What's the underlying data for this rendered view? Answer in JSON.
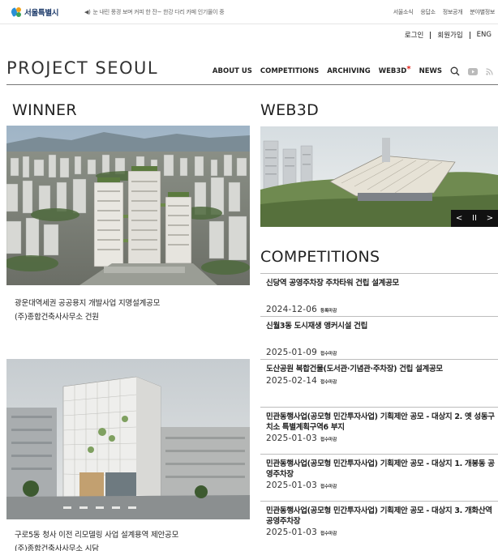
{
  "govbar": {
    "logo_text": "서울특별시",
    "ticker": "눈 내린 풍경 보며 커피 한 잔~ 한강 다리 카페 인기몰이 중",
    "links": [
      "서울소식",
      "응답소",
      "정보공개",
      "분야별정보"
    ]
  },
  "userbar": {
    "login": "로그인",
    "signup": "회원가입",
    "lang": "ENG"
  },
  "brand": {
    "title": "PROJECT SEOUL"
  },
  "nav": {
    "items": [
      "ABOUT US",
      "COMPETITIONS",
      "ARCHIVING",
      "WEB3D",
      "NEWS"
    ],
    "star": "*",
    "icons": [
      "search-icon",
      "youtube-icon",
      "rss-icon"
    ]
  },
  "winner": {
    "title": "WINNER",
    "items": [
      {
        "line1": "광운대역세권 공공용지 개발사업 지명설계공모",
        "line2": "(주)종합건축사사무소 건원"
      },
      {
        "line1": "구로5동 청사 이전 리모델링 사업 설계용역 제안공모",
        "line2": "(주)종합건축사사무소 시담"
      }
    ]
  },
  "web3d": {
    "title": "WEB3D",
    "controls": {
      "prev": "<",
      "pause": "II",
      "next": ">"
    }
  },
  "competitions": {
    "title": "COMPETITIONS",
    "items": [
      {
        "title": "신당역 공영주차장 주차타워 건립 설계공모",
        "date": "2024-12-06",
        "status": "등록마감"
      },
      {
        "title": "신월3동 도시재생 앵커시설 건립",
        "date": "2025-01-09",
        "status": "접수마감"
      },
      {
        "title": "도산공원 복합건물(도서관·기념관·주차장) 건립 설계공모",
        "date": "2025-02-14",
        "status": "접수마감"
      },
      {
        "title": "민관동행사업(공모형 민간투자사업) 기획제안 공모 - 대상지 2. 옛 성동구치소 특별계획구역6 부지",
        "date": "2025-01-03",
        "status": "접수마감"
      },
      {
        "title": "민관동행사업(공모형 민간투자사업) 기획제안 공모 - 대상지 1. 개봉동 공영주차장",
        "date": "2025-01-03",
        "status": "접수마감"
      },
      {
        "title": "민관동행사업(공모형 민간투자사업) 기획제안 공모 - 대상지 3. 개화산역 공영주차장",
        "date": "2025-01-03",
        "status": "접수마감"
      }
    ]
  },
  "colors": {
    "accent_red": "#e2231a",
    "text": "#222222",
    "rule": "#777777"
  }
}
